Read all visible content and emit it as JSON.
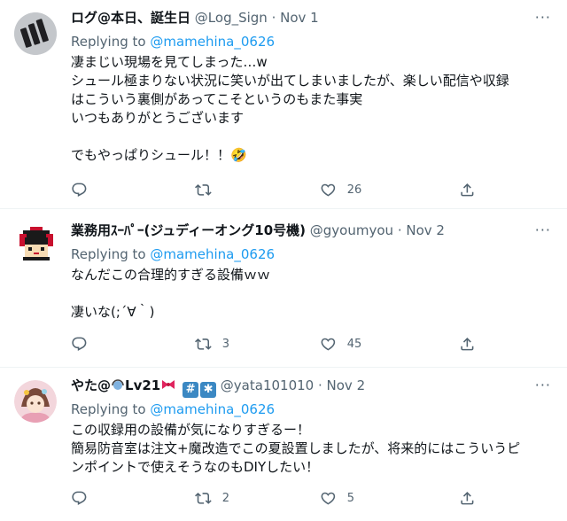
{
  "tweets": [
    {
      "name": "ログ@本日、誕生日",
      "handle": "@Log_Sign",
      "date": "· Nov 1",
      "replying_label": "Replying to",
      "replying_to": "@mamehina_0626",
      "lines": [
        "凄まじい現場を見てしまった…w",
        "シュール極まりない状況に笑いが出てしまいましたが、楽しい配信や収録",
        "はこういう裏側があってこそというのもまた事実",
        "いつもありがとうございます",
        "",
        "でもやっぱりシュール！！🤣"
      ],
      "reply_count": "",
      "retweet_count": "",
      "like_count": "26"
    },
    {
      "name": "業務用ｽｰﾊﾟｰ(ジュディーオング10号機)",
      "handle": "@gyoumyou",
      "date": "· Nov 2",
      "replying_label": "Replying to",
      "replying_to": "@mamehina_0626",
      "lines": [
        "なんだこの合理的すぎる設備ｗｗ",
        "",
        "凄いな(;´∀｀)"
      ],
      "reply_count": "",
      "retweet_count": "3",
      "like_count": "45"
    },
    {
      "name": "やた@",
      "name_suffix": "Lv21",
      "badge_1": "#",
      "badge_2": "✱",
      "handle": "@yata101010",
      "date": "· Nov 2",
      "replying_label": "Replying to",
      "replying_to": "@mamehina_0626",
      "lines": [
        "この収録用の設備が気になりすぎるー！",
        "簡易防音室は注文+魔改造でこの夏設置しましたが、将来的にはこういうピ",
        "ンポイントで使えそうなのもDIYしたい！"
      ],
      "reply_count": "",
      "retweet_count": "2",
      "like_count": "5"
    }
  ],
  "colors": {
    "text": "#0f1419",
    "muted": "#536471",
    "link": "#1d9bf0",
    "divider": "#eff3f4"
  },
  "icons": [
    "reply-icon",
    "retweet-icon",
    "like-icon",
    "share-icon",
    "more-icon"
  ]
}
